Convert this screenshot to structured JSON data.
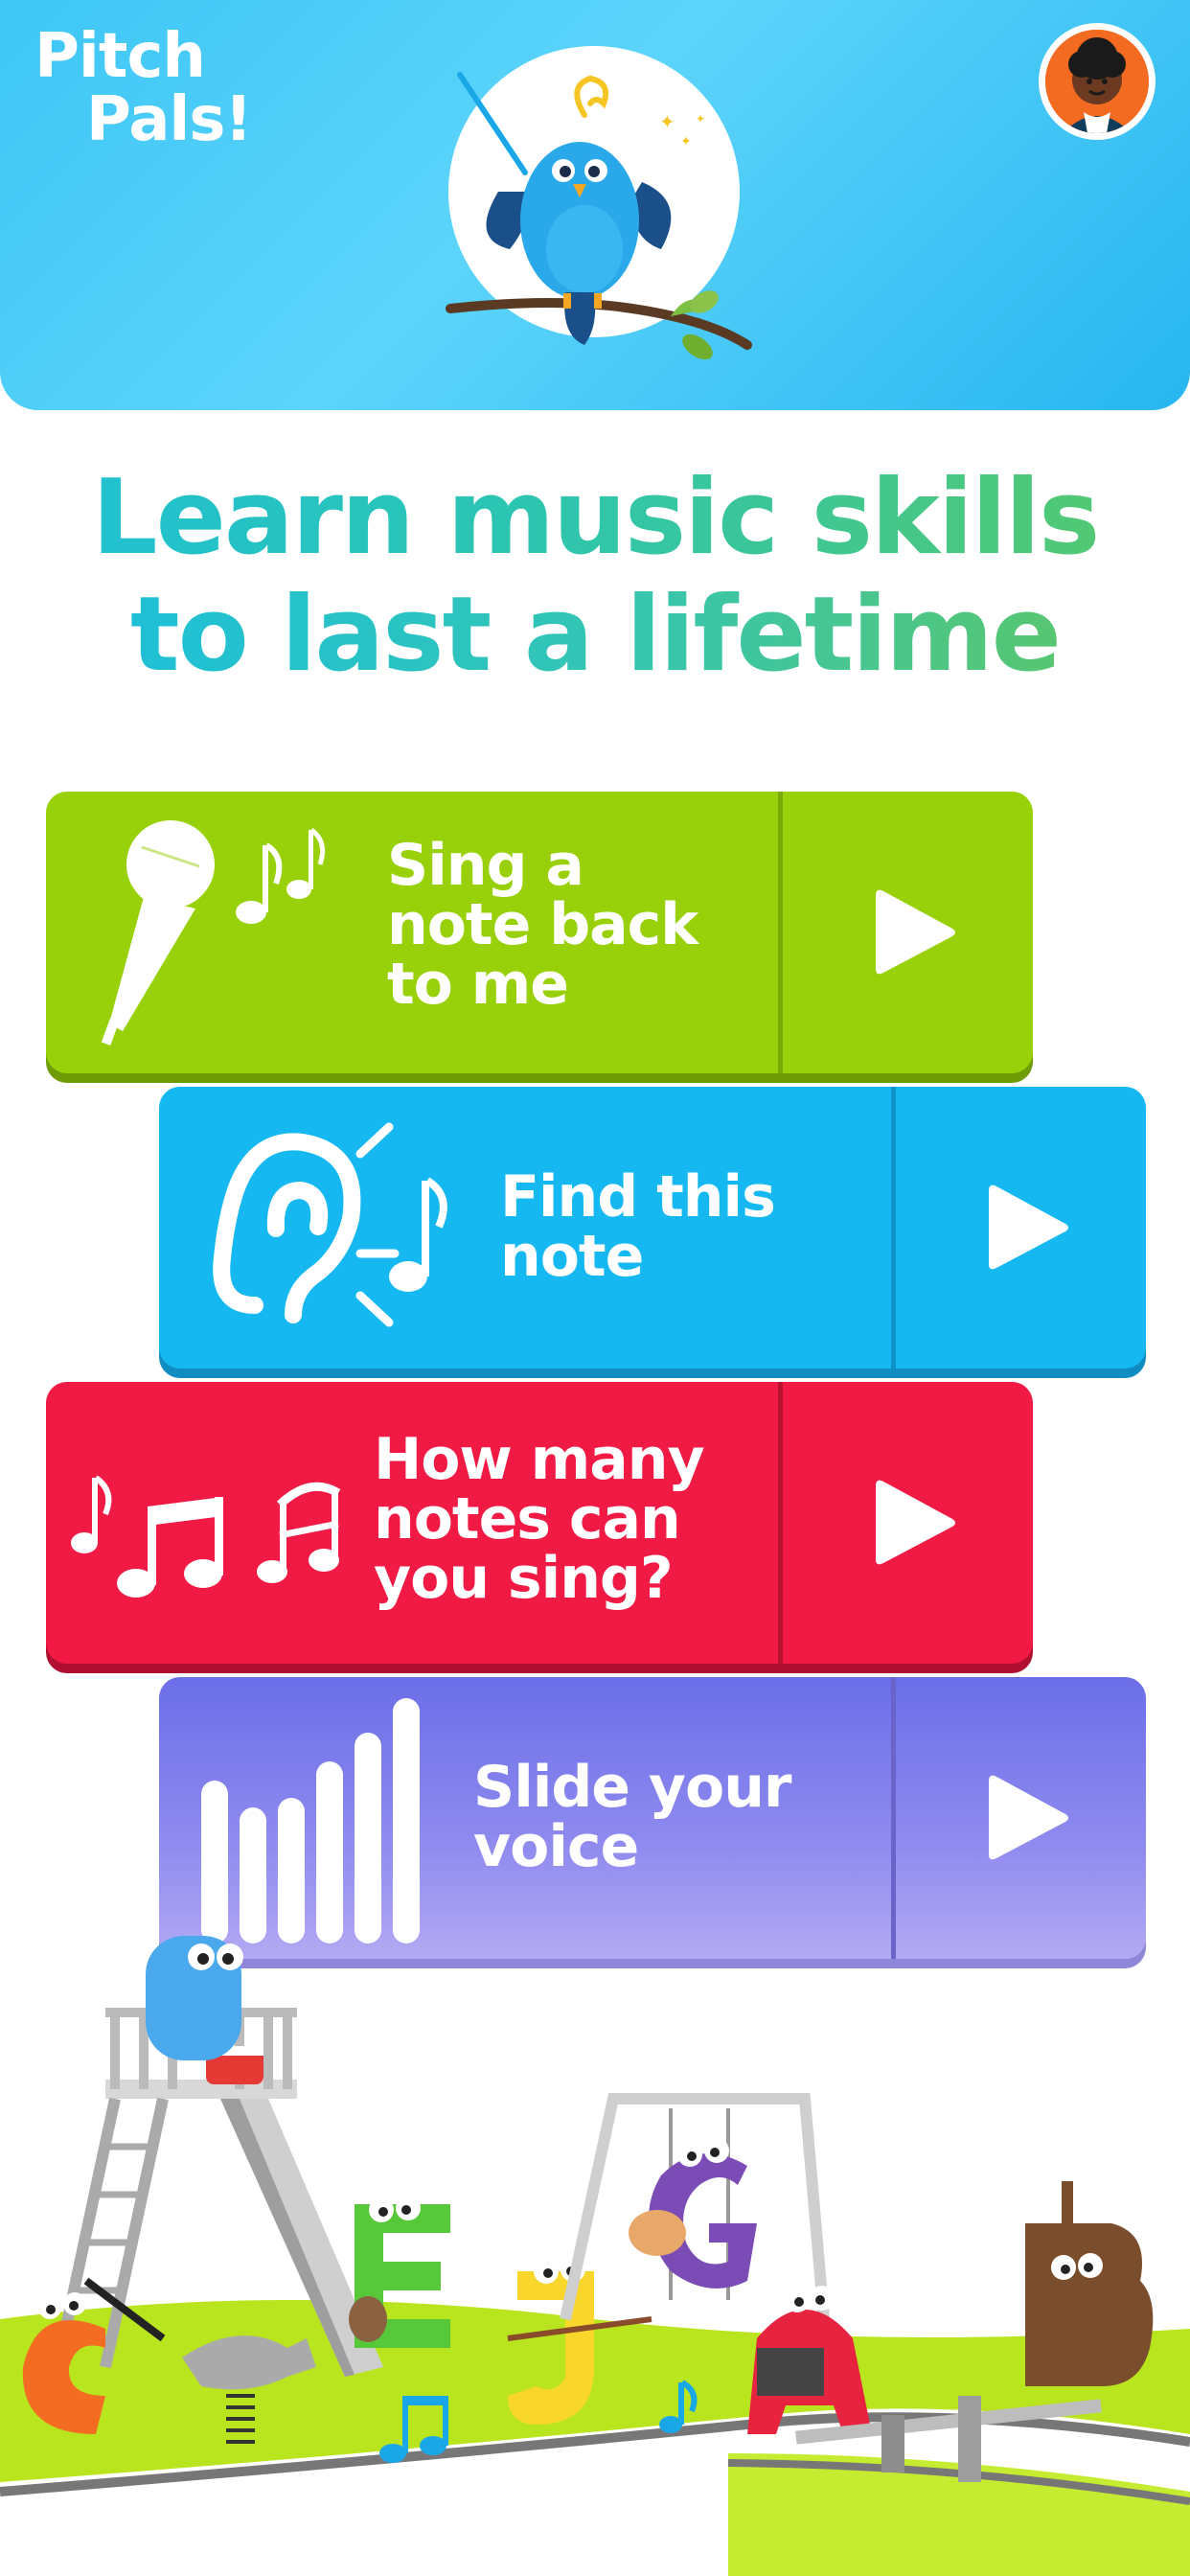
{
  "app": {
    "brand_line1": "Pitch",
    "brand_line2": "Pals!"
  },
  "headline": {
    "line1": "Learn music skills",
    "line2": "to last a lifetime"
  },
  "activities": [
    {
      "label": "Sing a\nnote back\nto me",
      "icon": "microphone-icon",
      "color": "#98d10a"
    },
    {
      "label": "Find this\nnote",
      "icon": "ear-icon",
      "color": "#16b8f2"
    },
    {
      "label": "How many\nnotes can\nyou sing?",
      "icon": "music-notes-icon",
      "color": "#f01a45"
    },
    {
      "label": "Slide your\nvoice",
      "icon": "volume-bars-icon",
      "color": "#6b6ee8"
    }
  ],
  "icons": {
    "play": "play-icon",
    "avatar": "profile-avatar",
    "mascot": "bird-conductor-mascot"
  }
}
